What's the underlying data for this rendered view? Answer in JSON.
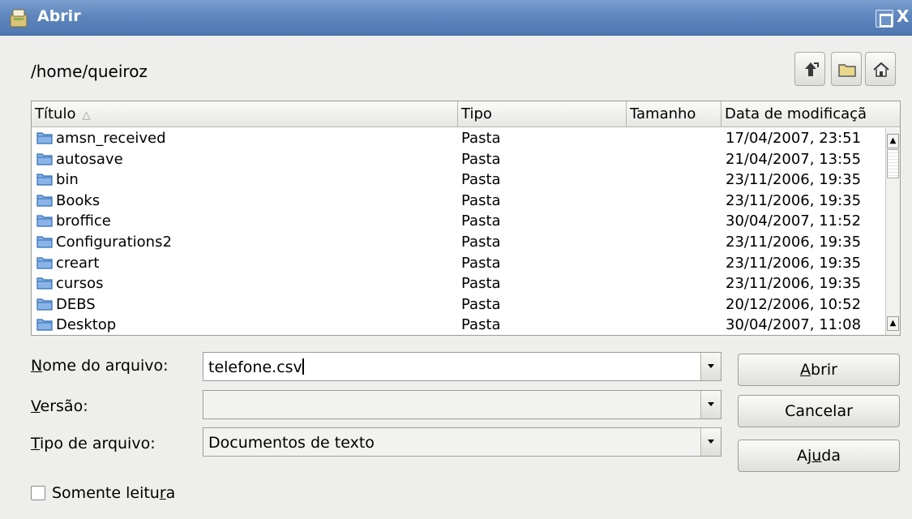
{
  "window": {
    "title": "Abrir",
    "close_glyph": "X"
  },
  "path": "/home/queiroz",
  "toolbar": {
    "up_icon": "up-folder-icon",
    "new_folder_icon": "new-folder-icon",
    "home_icon": "home-icon"
  },
  "columns": {
    "title": "Título",
    "type": "Tipo",
    "size": "Tamanho",
    "date": "Data de modificaçã"
  },
  "files": [
    {
      "name": "amsn_received",
      "type": "Pasta",
      "date": "17/04/2007, 23:51"
    },
    {
      "name": "autosave",
      "type": "Pasta",
      "date": "21/04/2007, 13:55"
    },
    {
      "name": "bin",
      "type": "Pasta",
      "date": "23/11/2006, 19:35"
    },
    {
      "name": "Books",
      "type": "Pasta",
      "date": "23/11/2006, 19:35"
    },
    {
      "name": "broffice",
      "type": "Pasta",
      "date": "30/04/2007, 11:52"
    },
    {
      "name": "Configurations2",
      "type": "Pasta",
      "date": "23/11/2006, 19:35"
    },
    {
      "name": "creart",
      "type": "Pasta",
      "date": "23/11/2006, 19:35"
    },
    {
      "name": "cursos",
      "type": "Pasta",
      "date": "23/11/2006, 19:35"
    },
    {
      "name": "DEBS",
      "type": "Pasta",
      "date": "20/12/2006, 10:52"
    },
    {
      "name": "Desktop",
      "type": "Pasta",
      "date": "30/04/2007, 11:08"
    }
  ],
  "form": {
    "filename_label_u": "N",
    "filename_label_rest": "ome do arquivo:",
    "filename_value": "telefone.csv",
    "version_label_u": "V",
    "version_label_rest": "ersão:",
    "version_value": "",
    "filetype_label_u": "T",
    "filetype_label_rest": "ipo de arquivo:",
    "filetype_value": "Documentos de texto"
  },
  "buttons": {
    "open_u": "A",
    "open_rest": "brir",
    "cancel": "Cancelar",
    "help_pre": "Aj",
    "help_u": "u",
    "help_post": "da"
  },
  "readonly": {
    "label_pre": "Somente leitu",
    "label_u": "r",
    "label_post": "a",
    "checked": false
  }
}
